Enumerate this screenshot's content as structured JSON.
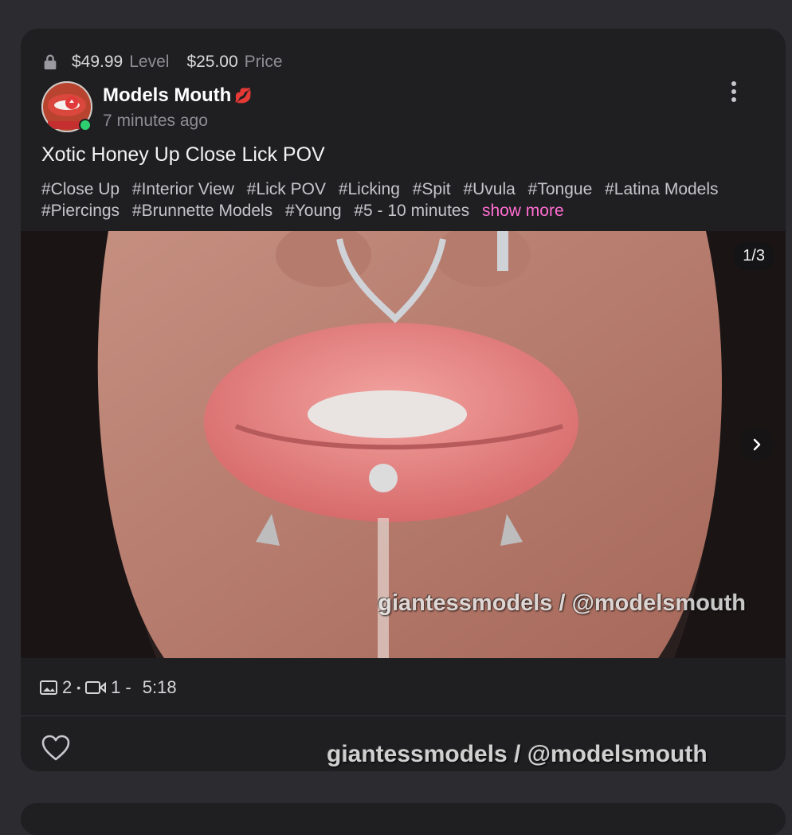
{
  "post": {
    "level_price": "$49.99",
    "level_label": "Level",
    "price_value": "$25.00",
    "price_label": "Price",
    "author_name": "Models Mouth",
    "author_badge": "💋",
    "time_ago": "7 minutes ago",
    "title": "Xotic Honey Up Close Lick POV",
    "tags": [
      "#Close Up",
      "#Interior View",
      "#Lick POV",
      "#Licking",
      "#Spit",
      "#Uvula",
      "#Tongue",
      "#Latina Models",
      "#Piercings",
      "#Brunnette Models",
      "#Young",
      "#5 - 10 minutes"
    ],
    "show_more": "show more"
  },
  "media": {
    "counter": "1/3",
    "watermark": "giantessmodels / @modelsmouth"
  },
  "stats": {
    "images": "2",
    "separator_dot": "•",
    "videos": "1",
    "separator_dash": "-",
    "duration": "5:18"
  },
  "footer": {
    "watermark": "giantessmodels / @modelsmouth"
  },
  "colors": {
    "accent": "#ff6ed1",
    "online": "#2ecf71",
    "card_bg": "#1f1f22",
    "page_bg": "#2b2b30"
  },
  "icons": [
    "lock-icon",
    "kebab-menu-icon",
    "image-icon",
    "video-icon",
    "chevron-right-icon",
    "heart-icon"
  ]
}
